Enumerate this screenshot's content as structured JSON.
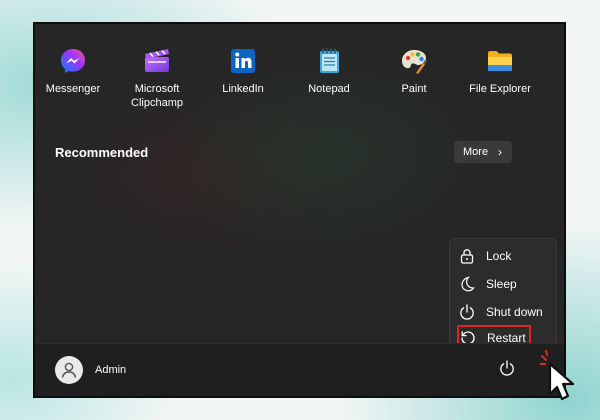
{
  "pinned_apps": [
    {
      "name": "Messenger",
      "icon": "messenger-icon"
    },
    {
      "name": "Microsoft\nClipchamp",
      "line1": "Microsoft",
      "line2": "Clipchamp",
      "icon": "clipchamp-icon"
    },
    {
      "name": "LinkedIn",
      "icon": "linkedin-icon"
    },
    {
      "name": "Notepad",
      "icon": "notepad-icon"
    },
    {
      "name": "Paint",
      "icon": "paint-icon"
    },
    {
      "name": "File Explorer",
      "icon": "file-explorer-icon"
    }
  ],
  "recommended": {
    "title": "Recommended",
    "more_label": "More",
    "more_chevron": "›"
  },
  "power_menu": {
    "items": [
      {
        "label": "Lock",
        "icon": "lock-icon"
      },
      {
        "label": "Sleep",
        "icon": "moon-icon"
      },
      {
        "label": "Shut down",
        "icon": "power-icon"
      },
      {
        "label": "Restart",
        "icon": "restart-icon",
        "highlighted": true
      }
    ],
    "highlight_color": "#e02424"
  },
  "user": {
    "name": "Admin",
    "icon": "user-avatar-icon"
  },
  "power_button": {
    "icon": "power-icon"
  },
  "colors": {
    "menu_background": "#262626",
    "accent_highlight": "#e02424",
    "background_teal": "#9fdad6"
  }
}
